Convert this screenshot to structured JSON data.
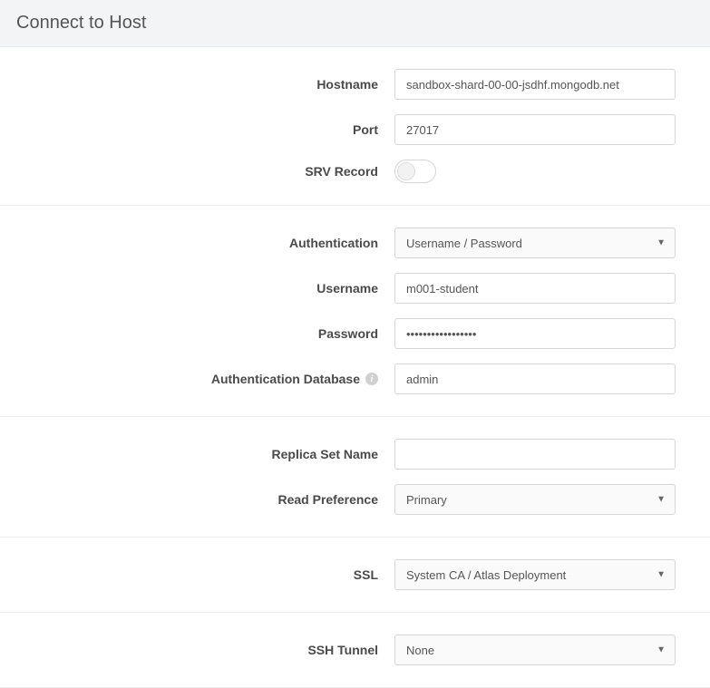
{
  "header": {
    "title": "Connect to Host"
  },
  "host": {
    "hostname_label": "Hostname",
    "hostname_value": "sandbox-shard-00-00-jsdhf.mongodb.net",
    "port_label": "Port",
    "port_value": "27017",
    "srv_label": "SRV Record"
  },
  "auth": {
    "authentication_label": "Authentication",
    "authentication_value": "Username / Password",
    "username_label": "Username",
    "username_value": "m001-student",
    "password_label": "Password",
    "password_value": "•••••••••••••••••",
    "authdb_label": "Authentication Database",
    "authdb_value": "admin"
  },
  "replica": {
    "replica_label": "Replica Set Name",
    "replica_value": "",
    "readpref_label": "Read Preference",
    "readpref_value": "Primary"
  },
  "ssl": {
    "ssl_label": "SSL",
    "ssl_value": "System CA / Atlas Deployment"
  },
  "ssh": {
    "ssh_label": "SSH Tunnel",
    "ssh_value": "None"
  }
}
